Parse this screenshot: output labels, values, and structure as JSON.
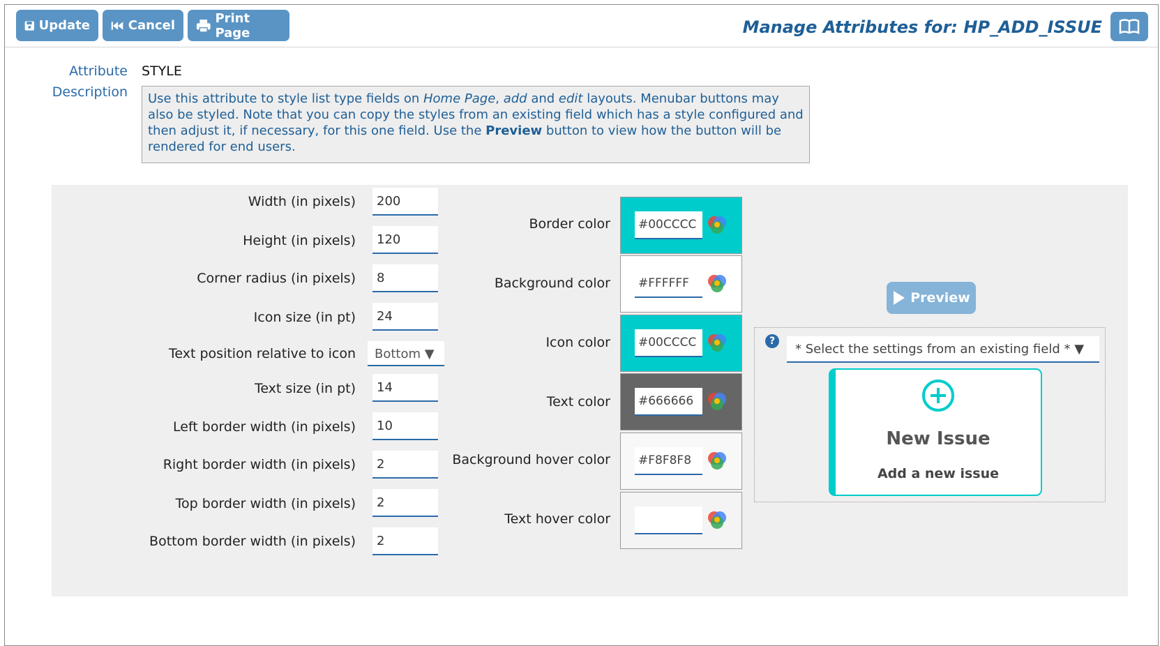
{
  "toolbar": {
    "update_label": "Update",
    "cancel_label": "Cancel",
    "print_label": "Print Page",
    "title": "Manage Attributes for: HP_ADD_ISSUE",
    "accent": "#5a94c4"
  },
  "attribute": {
    "label": "Attribute",
    "value": "STYLE",
    "description_label": "Description",
    "desc_1": "Use this attribute to style list type fields on ",
    "desc_home": "Home Page",
    "desc_2": ", ",
    "desc_add": "add",
    "desc_3": " and ",
    "desc_edit": "edit",
    "desc_4": " layouts. Menubar buttons may also be styled. Note that you can copy the styles from an existing field which has a style configured and then adjust it, if necessary, for this one field. Use the ",
    "desc_preview": "Preview",
    "desc_5": " button to view how the button will be rendered for end users."
  },
  "fields": [
    {
      "label": "Width (in pixels)",
      "value": "200"
    },
    {
      "label": "Height (in pixels)",
      "value": "120"
    },
    {
      "label": "Corner radius (in pixels)",
      "value": "8"
    },
    {
      "label": "Icon size (in pt)",
      "value": "24"
    },
    {
      "label": "Text position relative to icon",
      "value": "Bottom ▼"
    },
    {
      "label": "Text size (in pt)",
      "value": "14"
    },
    {
      "label": "Left border width (in pixels)",
      "value": "10"
    },
    {
      "label": "Right border width (in pixels)",
      "value": "2"
    },
    {
      "label": "Top border width (in pixels)",
      "value": "2"
    },
    {
      "label": "Bottom border width (in pixels)",
      "value": "2"
    }
  ],
  "colors": [
    {
      "label": "Border color",
      "value": "#00CCCC",
      "swatch": "#00CCCC"
    },
    {
      "label": "Background color",
      "value": "#FFFFFF",
      "swatch": "#FFFFFF"
    },
    {
      "label": "Icon color",
      "value": "#00CCCC",
      "swatch": "#00CCCC"
    },
    {
      "label": "Text color",
      "value": "#666666",
      "swatch": "#666666"
    },
    {
      "label": "Background hover color",
      "value": "#F8F8F8",
      "swatch": "#F8F8F8"
    },
    {
      "label": "Text hover color",
      "value": "",
      "swatch": "#F4F4F4"
    }
  ],
  "preview": {
    "button_label": "Preview",
    "help_symbol": "?",
    "settings_select": "* Select the settings from an existing field * ▼",
    "sample_title": "New Issue",
    "sample_subtitle": "Add a new issue"
  }
}
